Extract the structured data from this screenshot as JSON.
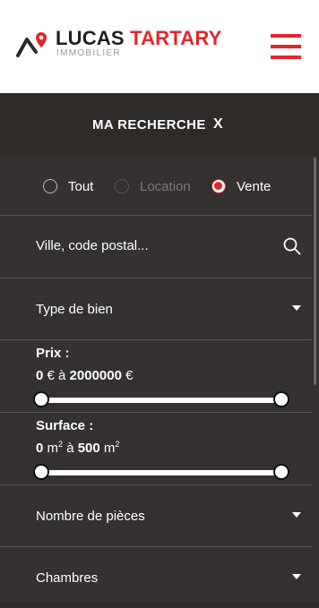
{
  "header": {
    "brand_part1": "LUCAS",
    "brand_part2": "TARTARY",
    "brand_sub": "IMMOBILIER",
    "menu_icon": "hamburger-icon",
    "accent_color": "#e3262b"
  },
  "panel": {
    "title": "MA RECHERCHE",
    "close_label": "X"
  },
  "filters": {
    "transaction": {
      "options": [
        {
          "label": "Tout",
          "state": "unchecked"
        },
        {
          "label": "Location",
          "state": "disabled"
        },
        {
          "label": "Vente",
          "state": "checked"
        }
      ]
    },
    "search": {
      "placeholder": "Ville, code postal...",
      "icon": "search-icon"
    },
    "type_bien": {
      "label": "Type de bien"
    },
    "prix": {
      "title": "Prix :",
      "min": "0",
      "currency": "€",
      "sep": "à",
      "max": "2000000",
      "min_fraction": 0,
      "max_fraction": 1
    },
    "surface": {
      "title": "Surface :",
      "min": "0",
      "unit": "m",
      "unit_exp": "2",
      "sep": "à",
      "max": "500",
      "min_fraction": 0,
      "max_fraction": 1
    },
    "pieces": {
      "label": "Nombre de pièces"
    },
    "chambres": {
      "label": "Chambres"
    }
  }
}
